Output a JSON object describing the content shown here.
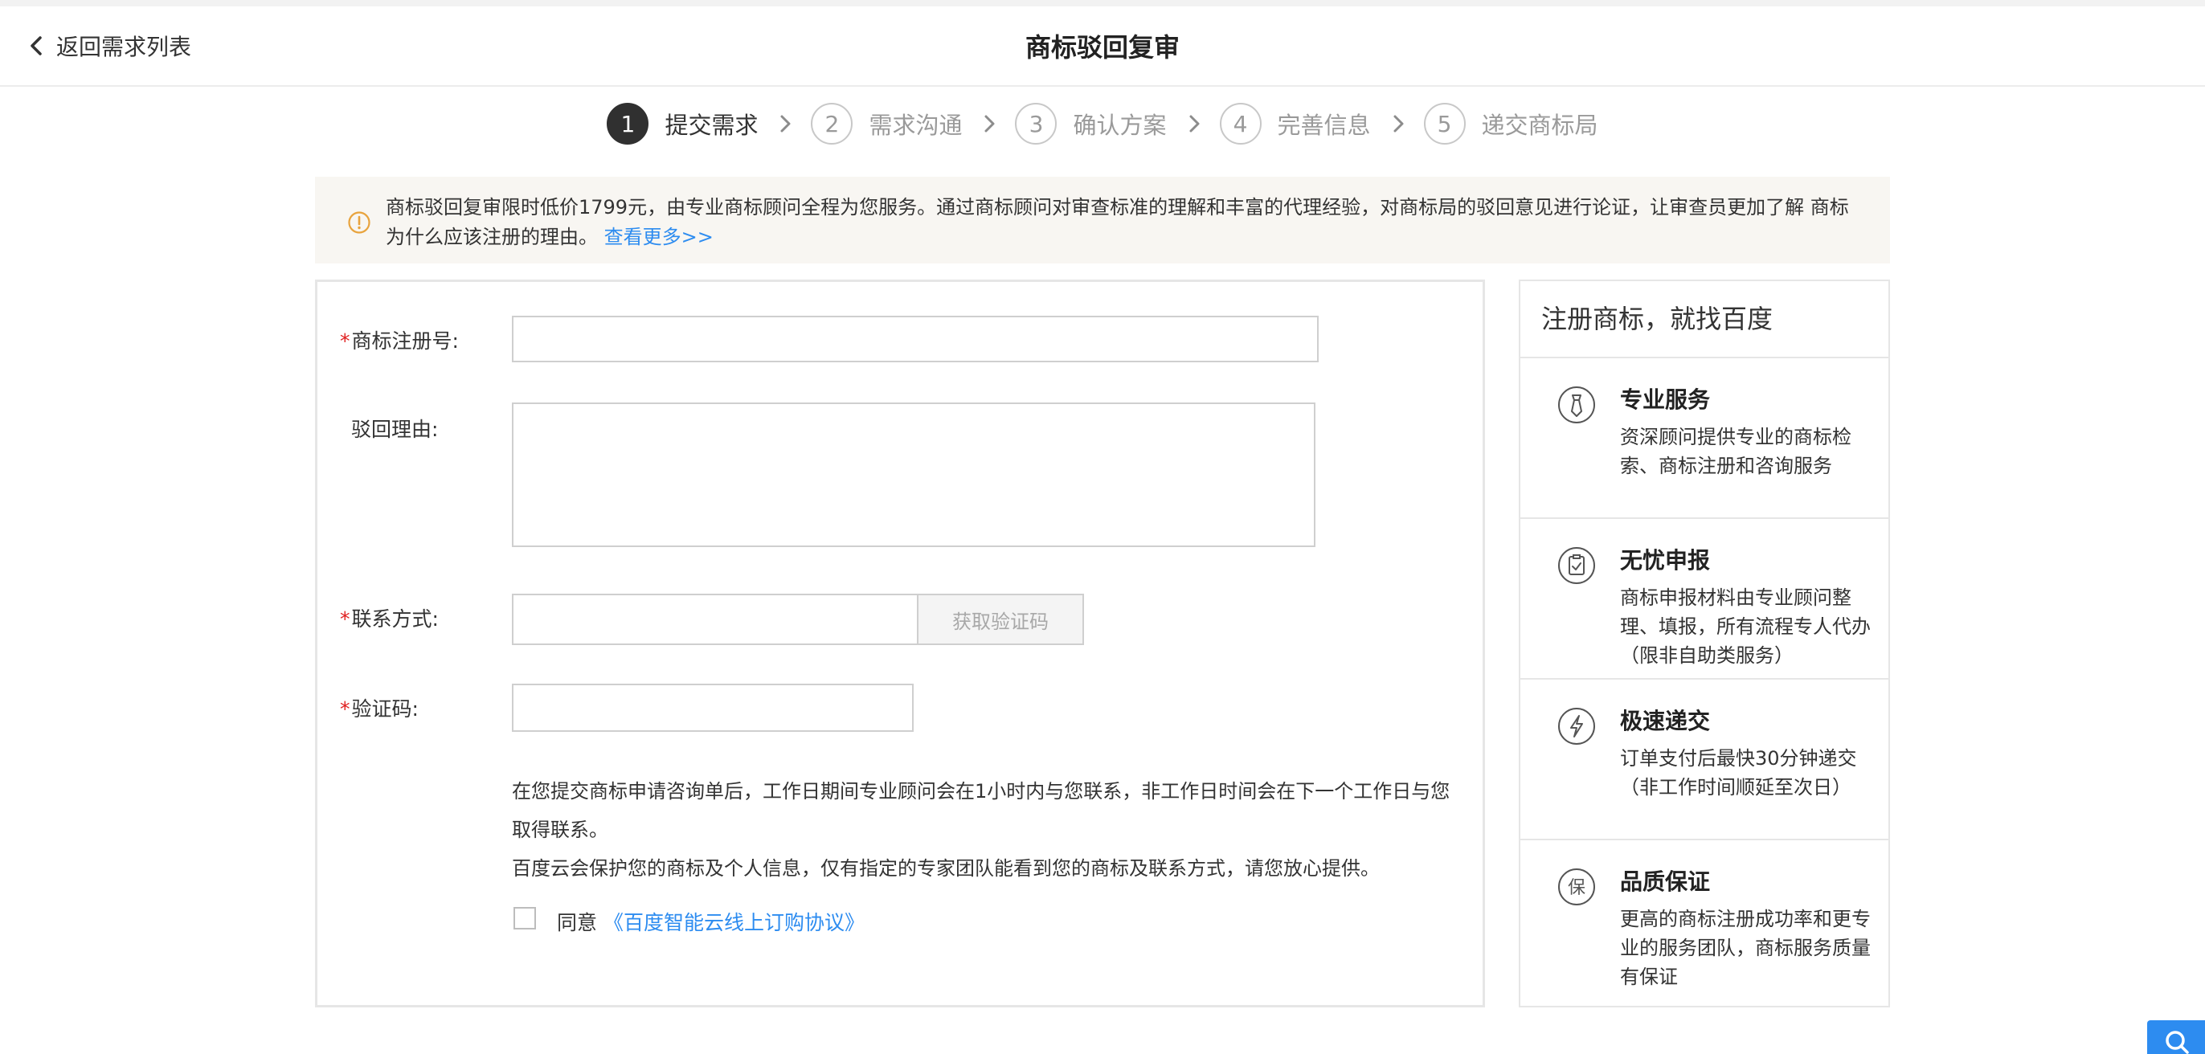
{
  "header": {
    "back_label": "返回需求列表",
    "title": "商标驳回复审"
  },
  "steps": [
    {
      "num": "1",
      "label": "提交需求",
      "active": true
    },
    {
      "num": "2",
      "label": "需求沟通",
      "active": false
    },
    {
      "num": "3",
      "label": "确认方案",
      "active": false
    },
    {
      "num": "4",
      "label": "完善信息",
      "active": false
    },
    {
      "num": "5",
      "label": "递交商标局",
      "active": false
    }
  ],
  "notice": {
    "icon": "info-circle-icon",
    "text": "商标驳回复审限时低价1799元，由专业商标顾问全程为您服务。通过商标顾问对审查标准的理解和丰富的代理经验，对商标局的驳回意见进行论证，让审查员更加了解 商标为什么应该注册的理由。",
    "link": "查看更多>>"
  },
  "form": {
    "reg_no_label": "商标注册号:",
    "reg_no_value": "",
    "reason_label": "驳回理由:",
    "reason_value": "",
    "contact_label": "联系方式:",
    "contact_value": "",
    "get_code_label": "获取验证码",
    "code_label": "验证码:",
    "code_value": "",
    "desc_line1": "在您提交商标申请咨询单后，工作日期间专业顾问会在1小时内与您联系，非工作日时间会在下一个工作日与您",
    "desc_line2": "取得联系。",
    "desc_line3": "百度云会保护您的商标及个人信息，仅有指定的专家团队能看到您的商标及联系方式，请您放心提供。",
    "agree_prefix": "同意",
    "agree_link": "《百度智能云线上订购协议》",
    "agree_checked": false
  },
  "side": {
    "title": "注册商标，就找百度",
    "items": [
      {
        "icon": "tie-icon",
        "title": "专业服务",
        "desc": "资深顾问提供专业的商标检索、商标注册和咨询服务"
      },
      {
        "icon": "clipboard-check-icon",
        "title": "无忧申报",
        "desc": "商标申报材料由专业顾问整理、填报，所有流程专人代办（限非自助类服务）"
      },
      {
        "icon": "lightning-icon",
        "title": "极速递交",
        "desc": "订单支付后最快30分钟递交（非工作时间顺延至次日）"
      },
      {
        "icon": "guarantee-icon",
        "title": "品质保证",
        "desc": "更高的商标注册成功率和更专业的服务团队，商标服务质量有保证"
      }
    ]
  },
  "colors": {
    "accent": "#2d8cf0",
    "required": "#e02020",
    "step_active": "#303030",
    "notice_bg": "#f8f6f2",
    "notice_icon": "#e8a33d"
  },
  "float_icon": "search-icon"
}
